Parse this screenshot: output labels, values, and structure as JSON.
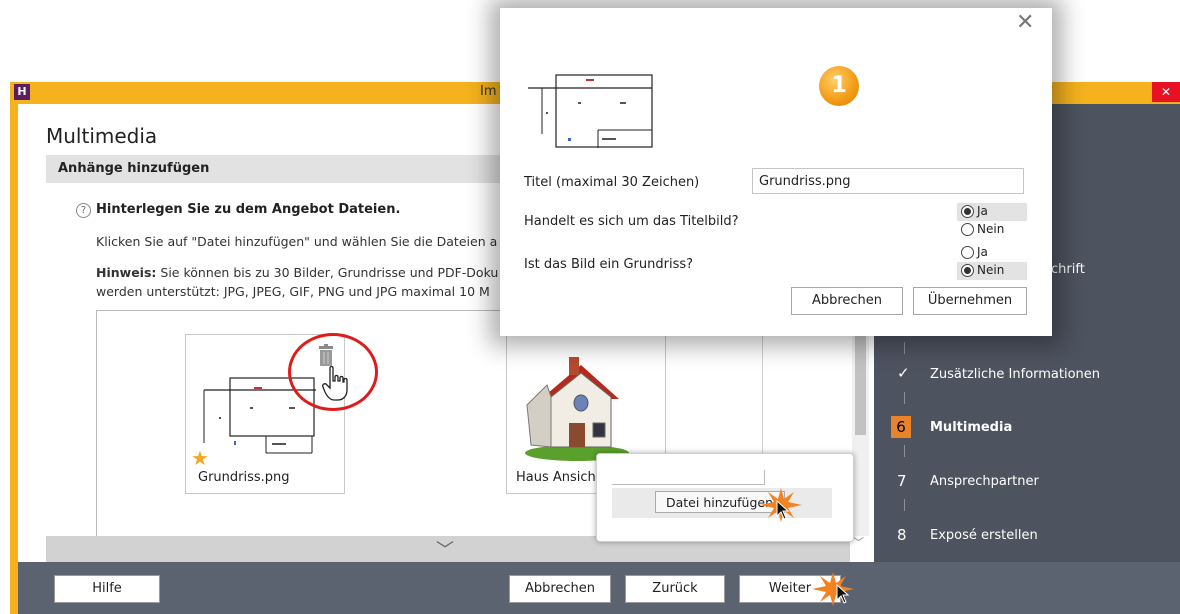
{
  "window": {
    "app_icon_letter": "H",
    "title": "Im",
    "close_glyph": "✕"
  },
  "page": {
    "title": "Multimedia",
    "section": "Anhänge hinzufügen",
    "help_glyph": "?",
    "hint_title": "Hinterlegen Sie zu dem Angebot Dateien.",
    "line1": "Klicken Sie auf \"Datei hinzufügen\" und wählen Sie die Dateien a",
    "line2_bold": "Hinweis:",
    "line2_rest": " Sie können bis zu 30 Bilder, Grundrisse und PDF-Doku",
    "line3": "werden unterstützt: JPG, JPEG, GIF, PNG und JPG maximal 10 M"
  },
  "gallery": {
    "items": [
      {
        "label": "Grundriss.png",
        "is_title_image": true
      },
      {
        "label": "Haus Ansich"
      }
    ],
    "star_glyph": "★",
    "chevron_glyph": "﹀",
    "scroll_down_glyph": "﹀"
  },
  "footer": {
    "help": "Hilfe",
    "cancel": "Abbrechen",
    "back": "Zurück",
    "next": "Weiter"
  },
  "sidebar": {
    "steps": [
      {
        "label": "chrift"
      },
      {
        "glyph": "✓",
        "label": "Zusätzliche Informationen"
      },
      {
        "number": "6",
        "label": "Multimedia",
        "active": true
      },
      {
        "number": "7",
        "label": "Ansprechpartner"
      },
      {
        "number": "8",
        "label": "Exposé erstellen"
      }
    ]
  },
  "dialog": {
    "close_glyph": "✕",
    "badge": "1",
    "title_label": "Titel (maximal 30 Zeichen)",
    "title_value": "Grundriss.png",
    "q_titelbild": "Handelt es sich um das Titelbild?",
    "q_grundriss": "Ist das Bild ein Grundriss?",
    "titelbild": {
      "yes": "Ja",
      "no": "Nein",
      "selected": "Ja"
    },
    "grundriss": {
      "yes": "Ja",
      "no": "Nein",
      "selected": "Nein"
    },
    "cancel": "Abbrechen",
    "apply": "Übernehmen"
  },
  "callout": {
    "add_file": "Datei hinzufügen"
  },
  "icons": {
    "trash": "trash-icon",
    "cursor": "hand-cursor-icon",
    "star": "star-icon",
    "close": "close-icon"
  },
  "colors": {
    "title_bar": "#f5b21e",
    "sidebar": "#4d535f",
    "footer": "#5c6370",
    "active_step": "#e8822b",
    "highlight_circle": "#e01b1b"
  }
}
